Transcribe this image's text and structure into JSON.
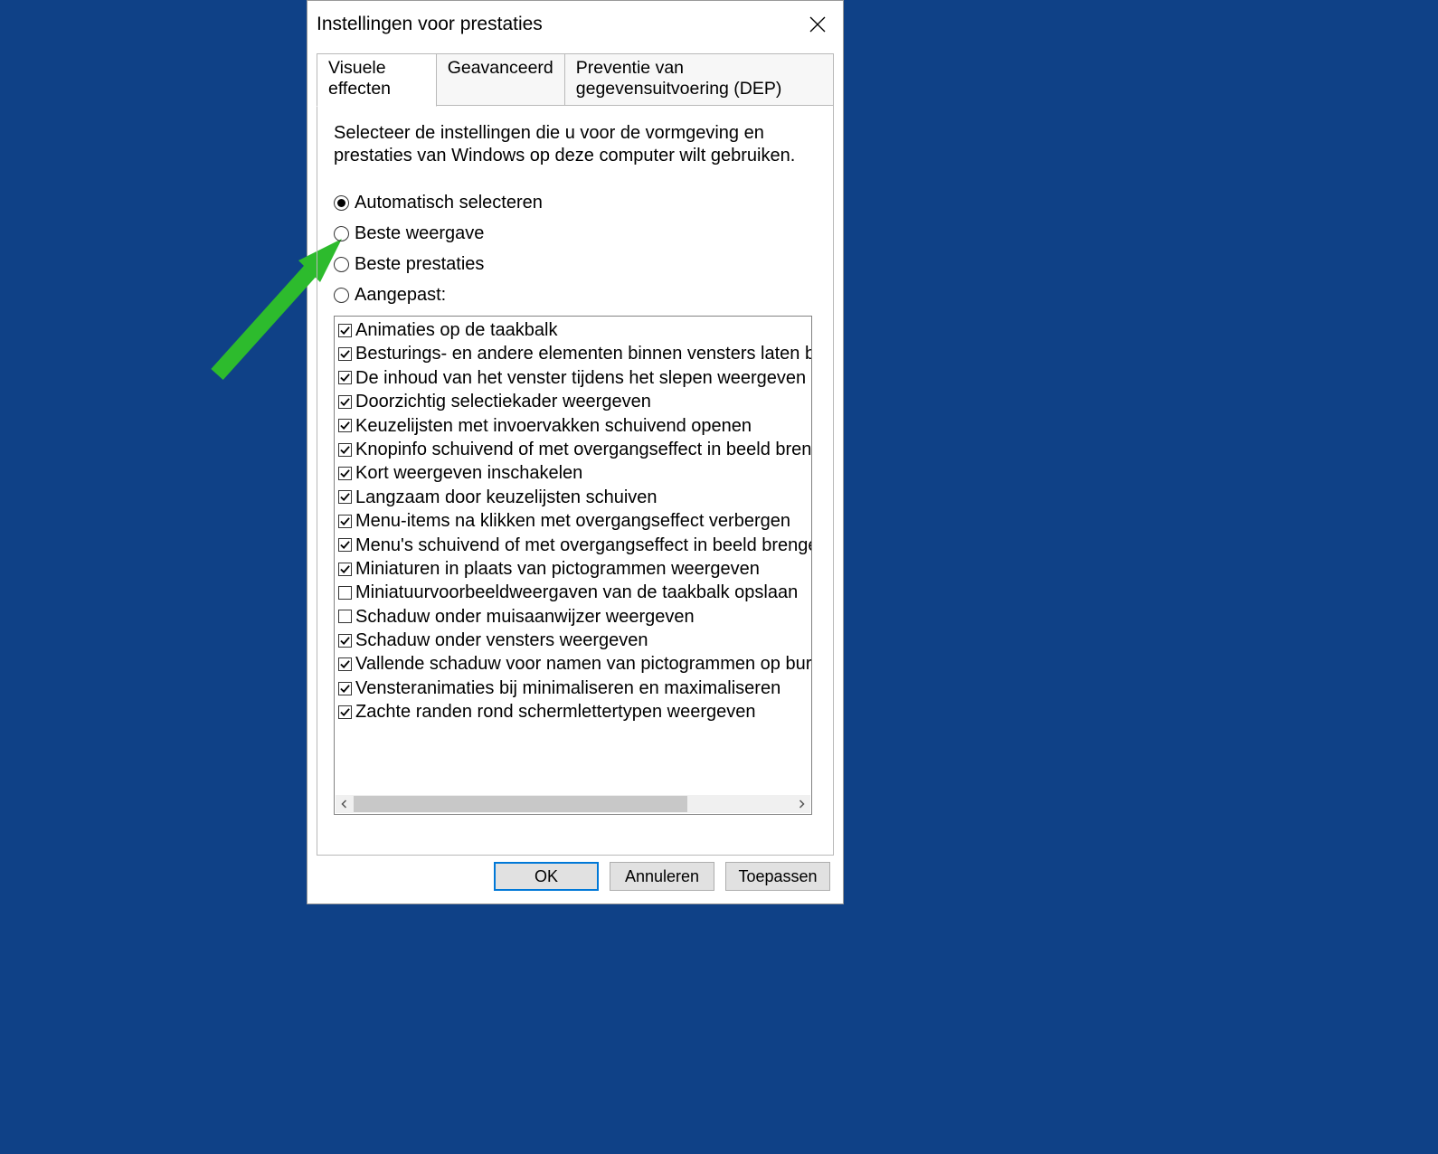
{
  "window": {
    "title": "Instellingen voor prestaties"
  },
  "tabs": {
    "visual": "Visuele effecten",
    "advanced": "Geavanceerd",
    "dep": "Preventie van gegevensuitvoering (DEP)"
  },
  "description": "Selecteer de instellingen die u voor de vormgeving en prestaties van Windows op deze computer wilt gebruiken.",
  "radios": {
    "auto": "Automatisch selecteren",
    "best_appearance": "Beste weergave",
    "best_performance": "Beste prestaties",
    "custom": "Aangepast:"
  },
  "radio_selected": "auto",
  "options": [
    {
      "checked": true,
      "label": "Animaties op de taakbalk"
    },
    {
      "checked": true,
      "label": "Besturings- en andere elementen binnen vensters laten bewe"
    },
    {
      "checked": true,
      "label": "De inhoud van het venster tijdens het slepen weergeven"
    },
    {
      "checked": true,
      "label": "Doorzichtig selectiekader weergeven"
    },
    {
      "checked": true,
      "label": "Keuzelijsten met invoervakken schuivend openen"
    },
    {
      "checked": true,
      "label": "Knopinfo schuivend of met overgangseffect in beeld brengen"
    },
    {
      "checked": true,
      "label": "Kort weergeven inschakelen"
    },
    {
      "checked": true,
      "label": "Langzaam door keuzelijsten schuiven"
    },
    {
      "checked": true,
      "label": "Menu-items na klikken met overgangseffect verbergen"
    },
    {
      "checked": true,
      "label": "Menu's schuivend of met overgangseffect in beeld brengen"
    },
    {
      "checked": true,
      "label": "Miniaturen in plaats van pictogrammen weergeven"
    },
    {
      "checked": false,
      "label": "Miniatuurvoorbeeldweergaven van de taakbalk opslaan"
    },
    {
      "checked": false,
      "label": "Schaduw onder muisaanwijzer weergeven"
    },
    {
      "checked": true,
      "label": "Schaduw onder vensters weergeven"
    },
    {
      "checked": true,
      "label": "Vallende schaduw voor namen van pictogrammen op bureau"
    },
    {
      "checked": true,
      "label": "Vensteranimaties bij minimaliseren en maximaliseren"
    },
    {
      "checked": true,
      "label": "Zachte randen rond schermlettertypen weergeven"
    }
  ],
  "buttons": {
    "ok": "OK",
    "cancel": "Annuleren",
    "apply": "Toepassen"
  },
  "annotation": {
    "arrow_color": "#2dbb2d"
  }
}
